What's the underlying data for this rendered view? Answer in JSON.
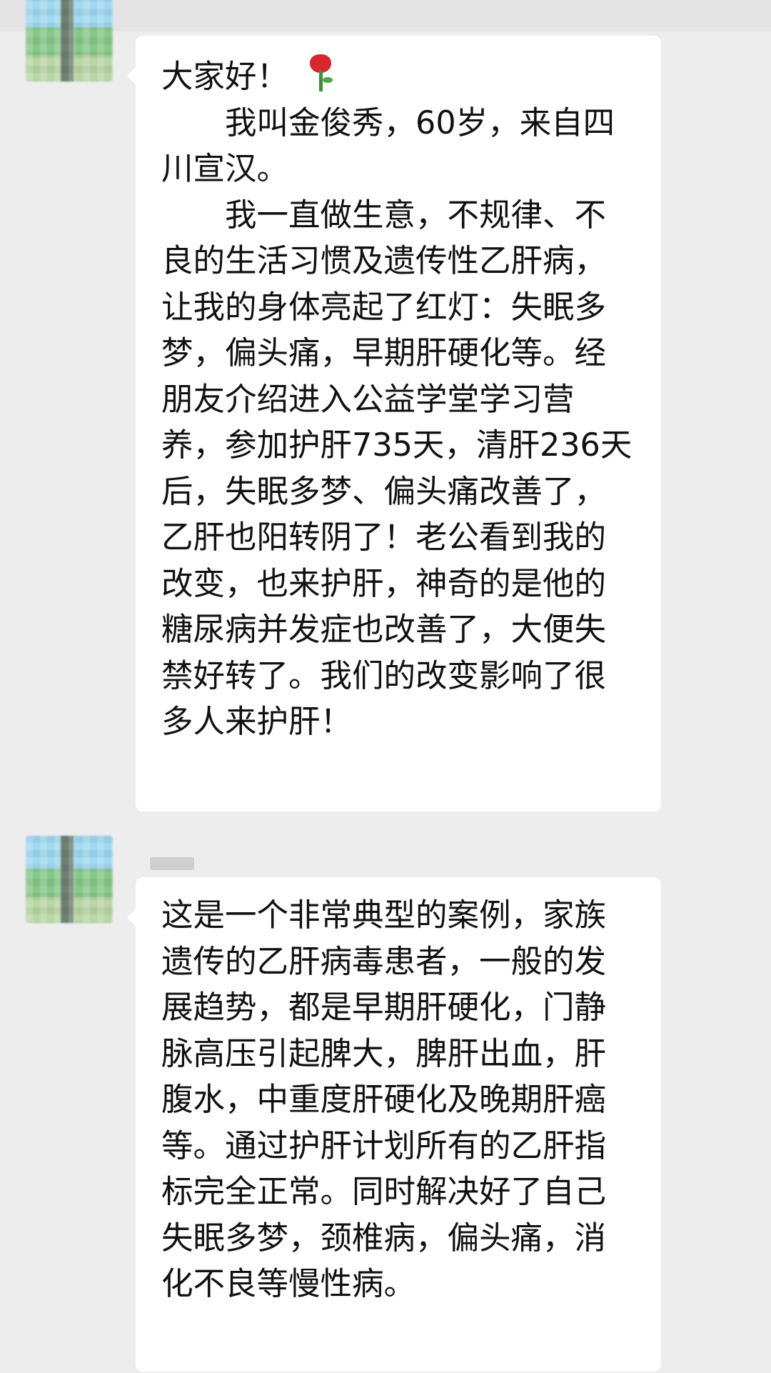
{
  "messages": [
    {
      "greeting": "大家好！",
      "emoji": "rose-icon",
      "paragraphs": [
        "　　我叫金俊秀，60岁，来自四川宣汉。",
        "　　我一直做生意，不规律、不良的生活习惯及遗传性乙肝病，让我的身体亮起了红灯：失眠多梦，偏头痛，早期肝硬化等。经朋友介绍进入公益学堂学习营养，参加护肝735天，清肝236天后，失眠多梦、偏头痛改善了，乙肝也阳转阴了！老公看到我的改变，也来护肝，神奇的是他的糖尿病并发症也改善了，大便失禁好转了。我们的改变影响了很多人来护肝！"
      ]
    },
    {
      "paragraphs": [
        "这是一个非常典型的案例，家族遗传的乙肝病毒患者，一般的发展趋势，都是早期肝硬化，门静脉高压引起脾大，脾肝出血，肝腹水，中重度肝硬化及晚期肝癌等。通过护肝计划所有的乙肝指标完全正常。同时解决好了自己失眠多梦，颈椎病，偏头痛，消化不良等慢性病。"
      ]
    }
  ]
}
